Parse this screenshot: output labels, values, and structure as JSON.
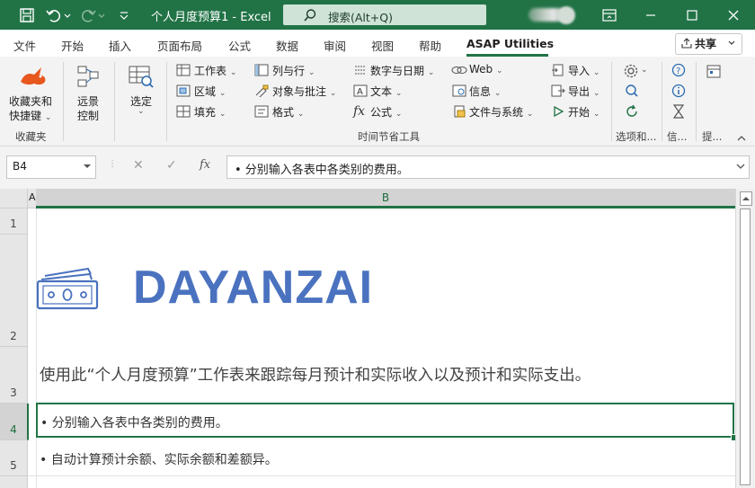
{
  "window": {
    "title": "个人月度预算1  -  Excel",
    "search_placeholder": "搜索(Alt+Q)",
    "colors": {
      "titlebar": "#217346",
      "accent": "#217346",
      "logo_text": "#4a72bf"
    }
  },
  "tabs": [
    {
      "label": "文件",
      "active": false
    },
    {
      "label": "开始",
      "active": false
    },
    {
      "label": "插入",
      "active": false
    },
    {
      "label": "页面布局",
      "active": false
    },
    {
      "label": "公式",
      "active": false
    },
    {
      "label": "数据",
      "active": false
    },
    {
      "label": "审阅",
      "active": false
    },
    {
      "label": "视图",
      "active": false
    },
    {
      "label": "帮助",
      "active": false
    },
    {
      "label": "ASAP Utilities",
      "active": true
    }
  ],
  "share_label": "共享",
  "ribbon": {
    "favorites": {
      "label_line1": "收藏夹和",
      "label_line2": "快捷键",
      "group": "收藏夹"
    },
    "remote": {
      "label_line1": "远景",
      "label_line2": "控制"
    },
    "select": {
      "label": "选定"
    },
    "col1": [
      "工作表",
      "区域",
      "填充"
    ],
    "col2": [
      "列与行",
      "对象与批注",
      "格式"
    ],
    "col3": [
      "数字与日期",
      "文本",
      "公式"
    ],
    "col4": [
      "Web",
      "信息",
      "文件与系统"
    ],
    "col5": [
      "导入",
      "导出",
      "开始"
    ],
    "group_time": "时间节省工具",
    "group_options": "选项和...",
    "group_info": "信...",
    "group_tips": "提..."
  },
  "formula_bar": {
    "name_box": "B4",
    "content": "• 分别输入各表中各类别的费用。"
  },
  "columns": [
    "A",
    "B"
  ],
  "rows": [
    "1",
    "2",
    "3",
    "4",
    "5"
  ],
  "sheet": {
    "logo_text": "DAYANZAI",
    "description": "使用此“个人月度预算”工作表来跟踪每月预计和实际收入以及预计和实际支出。",
    "bullet1": "• 分别输入各表中各类别的费用。",
    "bullet2": "• 自动计算预计余额、实际余额和差额异。"
  }
}
